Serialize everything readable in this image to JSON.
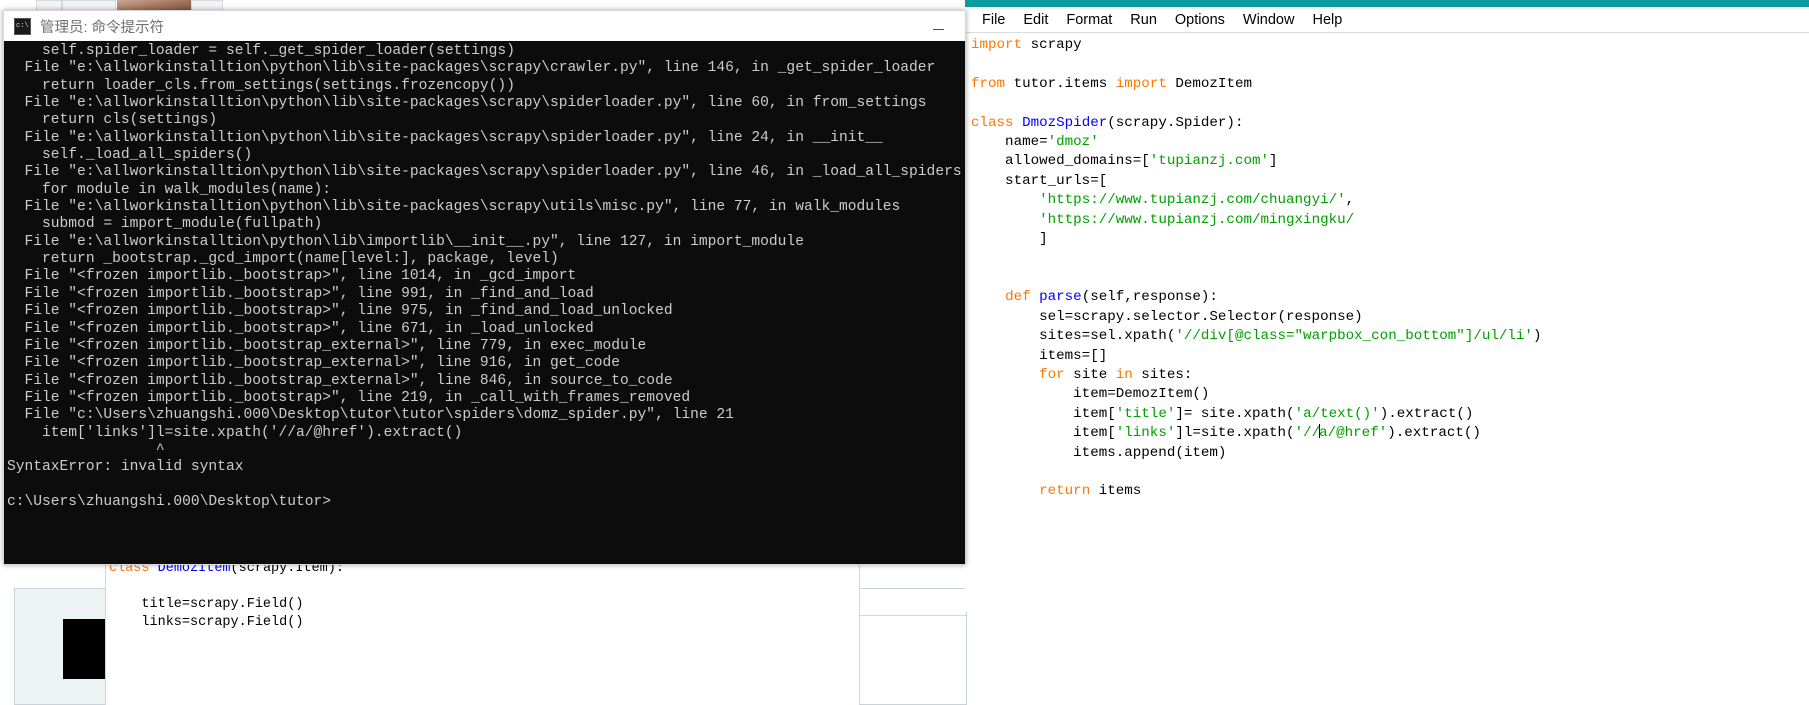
{
  "background": {
    "strip_label": ""
  },
  "cmd_window": {
    "title": "管理员: 命令提示符",
    "icon": "console-icon",
    "minimize_label": "—",
    "console_lines": [
      "    self.spider_loader = self._get_spider_loader(settings)",
      "  File \"e:\\allworkinstalltion\\python\\lib\\site-packages\\scrapy\\crawler.py\", line 146, in _get_spider_loader",
      "    return loader_cls.from_settings(settings.frozencopy())",
      "  File \"e:\\allworkinstalltion\\python\\lib\\site-packages\\scrapy\\spiderloader.py\", line 60, in from_settings",
      "    return cls(settings)",
      "  File \"e:\\allworkinstalltion\\python\\lib\\site-packages\\scrapy\\spiderloader.py\", line 24, in __init__",
      "    self._load_all_spiders()",
      "  File \"e:\\allworkinstalltion\\python\\lib\\site-packages\\scrapy\\spiderloader.py\", line 46, in _load_all_spiders",
      "    for module in walk_modules(name):",
      "  File \"e:\\allworkinstalltion\\python\\lib\\site-packages\\scrapy\\utils\\misc.py\", line 77, in walk_modules",
      "    submod = import_module(fullpath)",
      "  File \"e:\\allworkinstalltion\\python\\lib\\importlib\\__init__.py\", line 127, in import_module",
      "    return _bootstrap._gcd_import(name[level:], package, level)",
      "  File \"<frozen importlib._bootstrap>\", line 1014, in _gcd_import",
      "  File \"<frozen importlib._bootstrap>\", line 991, in _find_and_load",
      "  File \"<frozen importlib._bootstrap>\", line 975, in _find_and_load_unlocked",
      "  File \"<frozen importlib._bootstrap>\", line 671, in _load_unlocked",
      "  File \"<frozen importlib._bootstrap_external>\", line 779, in exec_module",
      "  File \"<frozen importlib._bootstrap_external>\", line 916, in get_code",
      "  File \"<frozen importlib._bootstrap_external>\", line 846, in source_to_code",
      "  File \"<frozen importlib._bootstrap>\", line 219, in _call_with_frames_removed",
      "  File \"c:\\Users\\zhuangshi.000\\Desktop\\tutor\\tutor\\spiders\\domz_spider.py\", line 21",
      "    item['links']l=site.xpath('//a/@href').extract()",
      "                 ^",
      "SyntaxError: invalid syntax",
      "",
      "c:\\Users\\zhuangshi.000\\Desktop\\tutor>"
    ]
  },
  "idle_window": {
    "accent_color": "#0c9c9c",
    "menus": [
      {
        "label": "File"
      },
      {
        "label": "Edit"
      },
      {
        "label": "Format"
      },
      {
        "label": "Run"
      },
      {
        "label": "Options"
      },
      {
        "label": "Window"
      },
      {
        "label": "Help"
      }
    ],
    "syntax_colors": {
      "keyword": "#ff7700",
      "definition": "#0000ff",
      "string": "#00a000",
      "text": "#000000"
    },
    "code_lines": [
      [
        {
          "t": "import",
          "c": "kw"
        },
        {
          "t": " scrapy",
          "c": "plain"
        }
      ],
      [
        {
          "t": "",
          "c": "plain"
        }
      ],
      [
        {
          "t": "from",
          "c": "kw"
        },
        {
          "t": " tutor.items ",
          "c": "plain"
        },
        {
          "t": "import",
          "c": "kw"
        },
        {
          "t": " DemozItem",
          "c": "plain"
        }
      ],
      [
        {
          "t": "",
          "c": "plain"
        }
      ],
      [
        {
          "t": "class",
          "c": "kw"
        },
        {
          "t": " ",
          "c": "plain"
        },
        {
          "t": "DmozSpider",
          "c": "def"
        },
        {
          "t": "(scrapy.Spider):",
          "c": "plain"
        }
      ],
      [
        {
          "t": "    name=",
          "c": "plain"
        },
        {
          "t": "'dmoz'",
          "c": "str"
        }
      ],
      [
        {
          "t": "    allowed_domains=[",
          "c": "plain"
        },
        {
          "t": "'tupianzj.com'",
          "c": "str"
        },
        {
          "t": "]",
          "c": "plain"
        }
      ],
      [
        {
          "t": "    start_urls=[",
          "c": "plain"
        }
      ],
      [
        {
          "t": "        ",
          "c": "plain"
        },
        {
          "t": "'https://www.tupianzj.com/chuangyi/'",
          "c": "str"
        },
        {
          "t": ",",
          "c": "plain"
        }
      ],
      [
        {
          "t": "        ",
          "c": "plain"
        },
        {
          "t": "'https://www.tupianzj.com/mingxingku/",
          "c": "str"
        }
      ],
      [
        {
          "t": "        ]",
          "c": "plain"
        }
      ],
      [
        {
          "t": "",
          "c": "plain"
        }
      ],
      [
        {
          "t": "",
          "c": "plain"
        }
      ],
      [
        {
          "t": "    ",
          "c": "plain"
        },
        {
          "t": "def",
          "c": "kw"
        },
        {
          "t": " ",
          "c": "plain"
        },
        {
          "t": "parse",
          "c": "def"
        },
        {
          "t": "(self,response):",
          "c": "plain"
        }
      ],
      [
        {
          "t": "        sel=scrapy.selector.Selector(response)",
          "c": "plain"
        }
      ],
      [
        {
          "t": "        sites=sel.xpath(",
          "c": "plain"
        },
        {
          "t": "'//div[@class=\"warpbox_con_bottom\"]/ul/li'",
          "c": "str"
        },
        {
          "t": ")",
          "c": "plain"
        }
      ],
      [
        {
          "t": "        items=[]",
          "c": "plain"
        }
      ],
      [
        {
          "t": "        ",
          "c": "plain"
        },
        {
          "t": "for",
          "c": "kw"
        },
        {
          "t": " site ",
          "c": "plain"
        },
        {
          "t": "in",
          "c": "kw"
        },
        {
          "t": " sites:",
          "c": "plain"
        }
      ],
      [
        {
          "t": "            item=DemozItem()",
          "c": "plain"
        }
      ],
      [
        {
          "t": "            item[",
          "c": "plain"
        },
        {
          "t": "'title'",
          "c": "str"
        },
        {
          "t": "]= site.xpath(",
          "c": "plain"
        },
        {
          "t": "'a/text()'",
          "c": "str"
        },
        {
          "t": ").extract()",
          "c": "plain"
        }
      ],
      [
        {
          "t": "            item[",
          "c": "plain"
        },
        {
          "t": "'links'",
          "c": "str"
        },
        {
          "t": "]l=site.xpath(",
          "c": "plain"
        },
        {
          "t": "'//",
          "c": "str"
        },
        {
          "t": "|CARET|",
          "c": "caret"
        },
        {
          "t": "a/@href'",
          "c": "str"
        },
        {
          "t": ").extract()",
          "c": "plain"
        }
      ],
      [
        {
          "t": "            items.append(item)",
          "c": "plain"
        }
      ],
      [
        {
          "t": "",
          "c": "plain"
        }
      ],
      [
        {
          "t": "        ",
          "c": "plain"
        },
        {
          "t": "return",
          "c": "kw"
        },
        {
          "t": " items",
          "c": "plain"
        }
      ]
    ]
  },
  "items_editor": {
    "code_lines": [
      [
        {
          "t": "class",
          "c": "kw"
        },
        {
          "t": " ",
          "c": "plain"
        },
        {
          "t": "DemozItem",
          "c": "def"
        },
        {
          "t": "(scrapy.Item):",
          "c": "plain"
        }
      ],
      [
        {
          "t": "",
          "c": "plain"
        }
      ],
      [
        {
          "t": "    title=scrapy.Field()",
          "c": "plain"
        }
      ],
      [
        {
          "t": "    links=scrapy.Field()",
          "c": "plain"
        }
      ]
    ]
  }
}
